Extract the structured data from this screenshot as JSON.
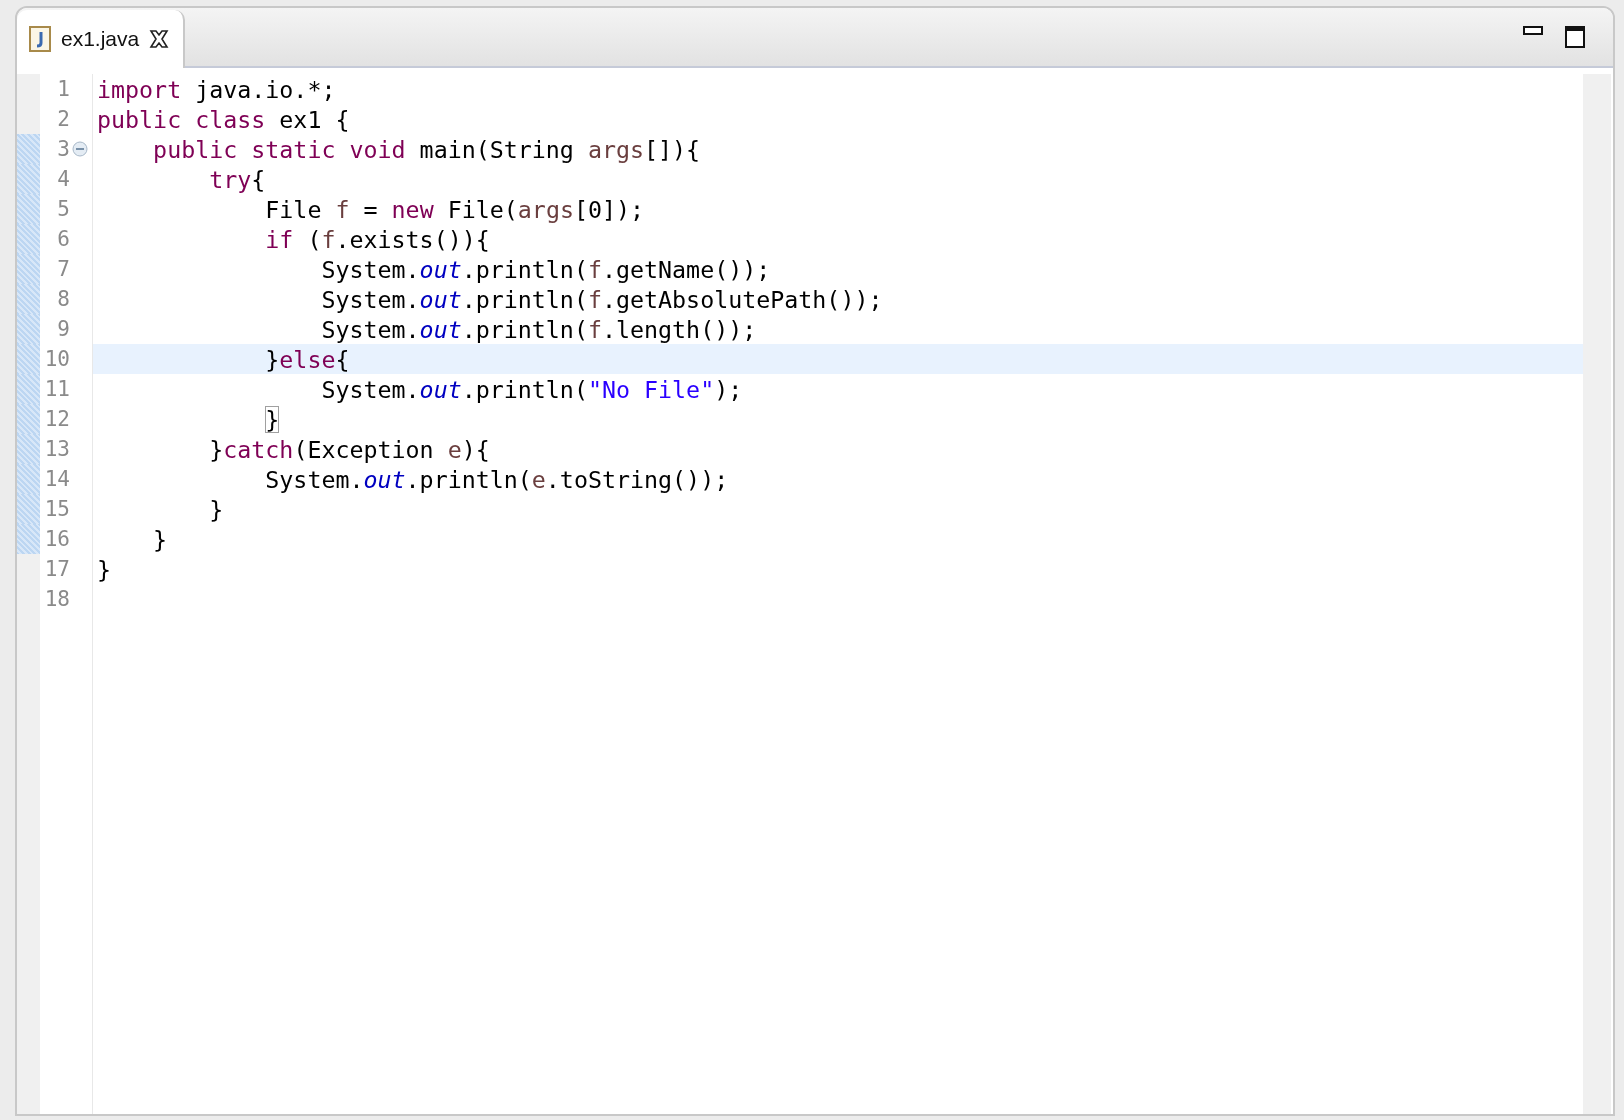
{
  "tabs": [
    {
      "label": "ex1.java",
      "selected": true
    }
  ],
  "editor": {
    "lines": [
      {
        "number": "1",
        "changed": false,
        "current": false,
        "tokens": [
          {
            "kind": "keyword",
            "text": "import"
          },
          {
            "kind": "plain",
            "text": " java.io.*;"
          }
        ]
      },
      {
        "number": "2",
        "changed": false,
        "current": false,
        "tokens": [
          {
            "kind": "keyword",
            "text": "public class"
          },
          {
            "kind": "plain",
            "text": " ex1 {"
          }
        ]
      },
      {
        "number": "3",
        "changed": true,
        "current": false,
        "expanded": true,
        "tokens": [
          {
            "kind": "keyword",
            "text": "    public static void"
          },
          {
            "kind": "plain",
            "text": " main(String "
          },
          {
            "kind": "variable",
            "text": "args"
          },
          {
            "kind": "plain",
            "text": "[]){"
          }
        ]
      },
      {
        "number": "4",
        "changed": true,
        "current": false,
        "tokens": [
          {
            "kind": "keyword",
            "text": "        try"
          },
          {
            "kind": "plain",
            "text": "{"
          }
        ]
      },
      {
        "number": "5",
        "changed": true,
        "current": false,
        "tokens": [
          {
            "kind": "plain",
            "text": "            File "
          },
          {
            "kind": "variable",
            "text": "f"
          },
          {
            "kind": "plain",
            "text": " = "
          },
          {
            "kind": "keyword",
            "text": "new"
          },
          {
            "kind": "plain",
            "text": " File("
          },
          {
            "kind": "variable",
            "text": "args"
          },
          {
            "kind": "plain",
            "text": "[0]);"
          }
        ]
      },
      {
        "number": "6",
        "changed": true,
        "current": false,
        "tokens": [
          {
            "kind": "keyword",
            "text": "            if"
          },
          {
            "kind": "plain",
            "text": " ("
          },
          {
            "kind": "variable",
            "text": "f"
          },
          {
            "kind": "plain",
            "text": ".exists()){"
          }
        ]
      },
      {
        "number": "7",
        "changed": true,
        "current": false,
        "tokens": [
          {
            "kind": "plain",
            "text": "                System."
          },
          {
            "kind": "field",
            "text": "out"
          },
          {
            "kind": "plain",
            "text": ".println("
          },
          {
            "kind": "variable",
            "text": "f"
          },
          {
            "kind": "plain",
            "text": ".getName());"
          }
        ]
      },
      {
        "number": "8",
        "changed": true,
        "current": false,
        "tokens": [
          {
            "kind": "plain",
            "text": "                System."
          },
          {
            "kind": "field",
            "text": "out"
          },
          {
            "kind": "plain",
            "text": ".println("
          },
          {
            "kind": "variable",
            "text": "f"
          },
          {
            "kind": "plain",
            "text": ".getAbsolutePath());"
          }
        ]
      },
      {
        "number": "9",
        "changed": true,
        "current": false,
        "tokens": [
          {
            "kind": "plain",
            "text": "                System."
          },
          {
            "kind": "field",
            "text": "out"
          },
          {
            "kind": "plain",
            "text": ".println("
          },
          {
            "kind": "variable",
            "text": "f"
          },
          {
            "kind": "plain",
            "text": ".length());"
          }
        ]
      },
      {
        "number": "10",
        "changed": true,
        "current": true,
        "tokens": [
          {
            "kind": "plain",
            "text": "            }"
          },
          {
            "kind": "keyword",
            "text": "else"
          },
          {
            "kind": "plain",
            "text": "{"
          }
        ]
      },
      {
        "number": "11",
        "changed": true,
        "current": false,
        "tokens": [
          {
            "kind": "plain",
            "text": "                System."
          },
          {
            "kind": "field",
            "text": "out"
          },
          {
            "kind": "plain",
            "text": ".println("
          },
          {
            "kind": "string",
            "text": "\"No File\""
          },
          {
            "kind": "plain",
            "text": ");"
          }
        ]
      },
      {
        "number": "12",
        "changed": true,
        "current": false,
        "tokens": [
          {
            "kind": "bracket-match",
            "text": "            }"
          }
        ]
      },
      {
        "number": "13",
        "changed": true,
        "current": false,
        "tokens": [
          {
            "kind": "plain",
            "text": "        }"
          },
          {
            "kind": "keyword",
            "text": "catch"
          },
          {
            "kind": "plain",
            "text": "(Exception "
          },
          {
            "kind": "variable",
            "text": "e"
          },
          {
            "kind": "plain",
            "text": "){"
          }
        ]
      },
      {
        "number": "14",
        "changed": true,
        "current": false,
        "tokens": [
          {
            "kind": "plain",
            "text": "            System."
          },
          {
            "kind": "field",
            "text": "out"
          },
          {
            "kind": "plain",
            "text": ".println("
          },
          {
            "kind": "variable",
            "text": "e"
          },
          {
            "kind": "plain",
            "text": ".toString());"
          }
        ]
      },
      {
        "number": "15",
        "changed": true,
        "current": false,
        "tokens": [
          {
            "kind": "plain",
            "text": "        }"
          }
        ]
      },
      {
        "number": "16",
        "changed": true,
        "current": false,
        "tokens": [
          {
            "kind": "plain",
            "text": "    }"
          }
        ]
      },
      {
        "number": "17",
        "changed": false,
        "current": false,
        "tokens": [
          {
            "kind": "plain",
            "text": "}"
          }
        ]
      },
      {
        "number": "18",
        "changed": false,
        "current": false
      }
    ]
  }
}
